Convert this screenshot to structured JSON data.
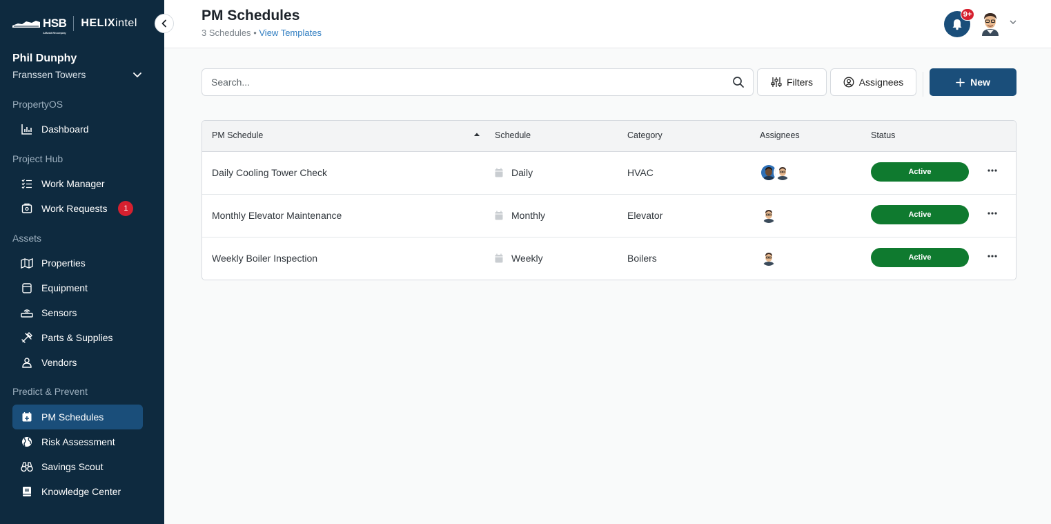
{
  "brand": {
    "hsb": "HSB",
    "hsb_sub": "A Munich Re company",
    "helix_bold": "HELIX",
    "helix_light": "intel"
  },
  "user": {
    "name": "Phil Dunphy",
    "property": "Franssen Towers"
  },
  "sidebar": {
    "sections": [
      {
        "label": "PropertyOS",
        "items": [
          {
            "label": "Dashboard",
            "icon": "chart-icon"
          }
        ]
      },
      {
        "label": "Project Hub",
        "items": [
          {
            "label": "Work Manager",
            "icon": "checklist-icon"
          },
          {
            "label": "Work Requests",
            "icon": "inbox-icon",
            "badge": "1"
          }
        ]
      },
      {
        "label": "Assets",
        "items": [
          {
            "label": "Properties",
            "icon": "map-icon"
          },
          {
            "label": "Equipment",
            "icon": "equipment-icon"
          },
          {
            "label": "Sensors",
            "icon": "sensor-icon"
          },
          {
            "label": "Parts & Supplies",
            "icon": "tools-icon"
          },
          {
            "label": "Vendors",
            "icon": "vendor-icon"
          }
        ]
      },
      {
        "label": "Predict & Prevent",
        "items": [
          {
            "label": "PM Schedules",
            "icon": "calendar-plus-icon",
            "active": true
          },
          {
            "label": "Risk Assessment",
            "icon": "globe-icon"
          },
          {
            "label": "Savings Scout",
            "icon": "binoculars-icon"
          },
          {
            "label": "Knowledge Center",
            "icon": "book-icon"
          }
        ]
      }
    ]
  },
  "header": {
    "title": "PM Schedules",
    "count": "3 Schedules",
    "separator": "•",
    "templates_link": "View Templates",
    "notification_badge": "9+"
  },
  "toolbar": {
    "search_placeholder": "Search...",
    "filters_label": "Filters",
    "assignees_label": "Assignees",
    "new_label": "New"
  },
  "table": {
    "columns": [
      "PM Schedule",
      "Schedule",
      "Category",
      "Assignees",
      "Status"
    ],
    "rows": [
      {
        "name": "Daily Cooling Tower Check",
        "schedule": "Daily",
        "category": "HVAC",
        "status": "Active"
      },
      {
        "name": "Monthly Elevator Maintenance",
        "schedule": "Monthly",
        "category": "Elevator",
        "status": "Active"
      },
      {
        "name": "Weekly Boiler Inspection",
        "schedule": "Weekly",
        "category": "Boilers",
        "status": "Active"
      }
    ]
  },
  "colors": {
    "sidebar_bg": "#0e2a3f",
    "primary": "#1a4e7a",
    "status_active": "#0f7a2f",
    "badge": "#d6202f",
    "link": "#2f7dc1"
  }
}
